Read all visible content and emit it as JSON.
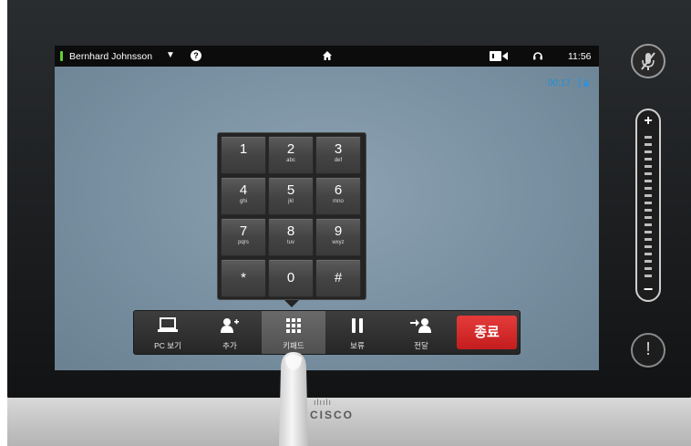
{
  "statusbar": {
    "user_name": "Bernhard Johnsson",
    "time": "11:56"
  },
  "call": {
    "duration": "00:17"
  },
  "keypad": {
    "keys": [
      {
        "digit": "1",
        "letters": ""
      },
      {
        "digit": "2",
        "letters": "abc"
      },
      {
        "digit": "3",
        "letters": "def"
      },
      {
        "digit": "4",
        "letters": "ghi"
      },
      {
        "digit": "5",
        "letters": "jkl"
      },
      {
        "digit": "6",
        "letters": "mno"
      },
      {
        "digit": "7",
        "letters": "pqrs"
      },
      {
        "digit": "8",
        "letters": "tuv"
      },
      {
        "digit": "9",
        "letters": "wxyz"
      },
      {
        "digit": "*",
        "letters": ""
      },
      {
        "digit": "0",
        "letters": ""
      },
      {
        "digit": "#",
        "letters": ""
      }
    ]
  },
  "toolbar": {
    "pc_view": "PC 보기",
    "add": "추가",
    "keypad": "키패드",
    "hold": "보류",
    "transfer": "전달",
    "end_call": "종료"
  },
  "brand": "CISCO",
  "colors": {
    "end_call": "#d42a2a",
    "timer": "#1f8fdc",
    "status_indicator": "#5fcf3a"
  }
}
